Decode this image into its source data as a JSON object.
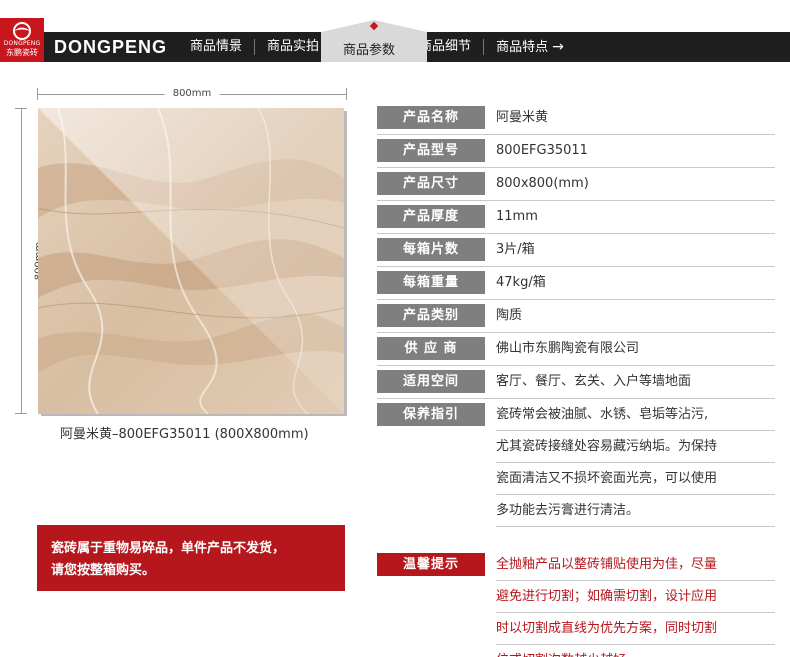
{
  "brand": {
    "logo_en": "DONGPENG",
    "logo_cn": "东鹏瓷砖",
    "wordmark": "DONGPENG"
  },
  "nav": {
    "items": [
      {
        "label": "商品情景"
      },
      {
        "label": "商品实拍"
      },
      {
        "label": "商品参数"
      },
      {
        "label": "商品细节"
      },
      {
        "label": "商品特点"
      }
    ],
    "arrow": "→",
    "active_index": 2
  },
  "tile": {
    "width_label": "800mm",
    "height_label": "800mm",
    "caption": "阿曼米黄–800EFG35011 (800X800mm)"
  },
  "notice": {
    "line1": "瓷砖属于重物易碎品，单件产品不发货，",
    "line2": "请您按整箱购买。"
  },
  "specs": [
    {
      "label": "产品名称",
      "value": "阿曼米黄"
    },
    {
      "label": "产品型号",
      "value": "800EFG35011"
    },
    {
      "label": "产品尺寸",
      "value": "800x800(mm)"
    },
    {
      "label": "产品厚度",
      "value": "11mm"
    },
    {
      "label": "每箱片数",
      "value": "3片/箱"
    },
    {
      "label": "每箱重量",
      "value": "47kg/箱"
    },
    {
      "label": "产品类别",
      "value": "陶质"
    },
    {
      "label": "供 应 商",
      "value": "佛山市东鹏陶瓷有限公司"
    },
    {
      "label": "适用空间",
      "value": "客厅、餐厅、玄关、入户等墙地面"
    }
  ],
  "care": {
    "label": "保养指引",
    "lines": [
      "瓷砖常会被油腻、水锈、皂垢等沾污,",
      "尤其瓷砖接缝处容易藏污纳垢。为保持",
      "瓷面清洁又不损坏瓷面光亮，可以使用",
      "多功能去污膏进行清洁。"
    ]
  },
  "tips": {
    "label": "温馨提示",
    "lines": [
      "全抛釉产品以整砖铺贴使用为佳，尽量",
      "避免进行切割；如确需切割，设计应用",
      "时以切割成直线为优先方案，同时切割",
      "位或切割次数越少越好。"
    ]
  },
  "colors": {
    "nav_bg": "#1f1f1f",
    "brand_red": "#b5171c",
    "label_gray": "#7f7f7f",
    "tile_beige": "#dcc3a8"
  }
}
